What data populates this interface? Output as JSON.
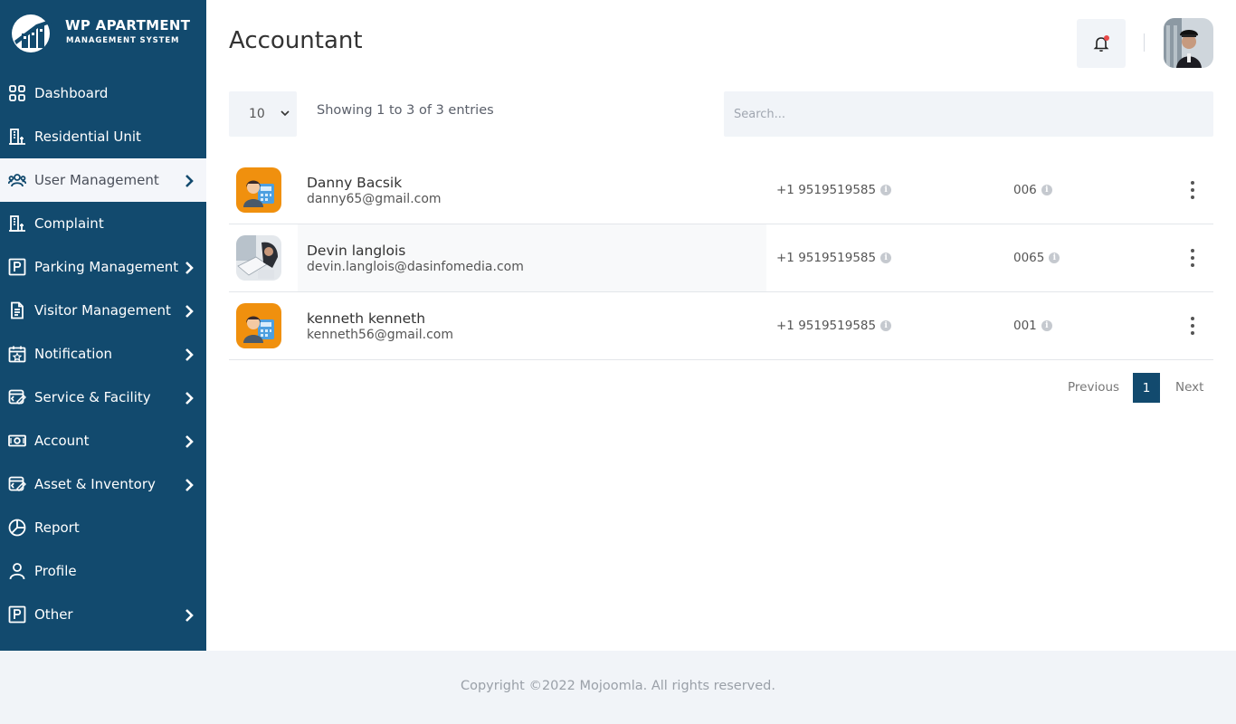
{
  "brand": {
    "title": "WP APARTMENT",
    "subtitle": "MANAGEMENT SYSTEM"
  },
  "sidebar": {
    "items": [
      {
        "label": "Dashboard",
        "icon": "dashboard-grid-icon"
      },
      {
        "label": "Residential Unit",
        "icon": "building-icon"
      },
      {
        "label": "User Management",
        "icon": "users-icon",
        "active": true
      },
      {
        "label": "Complaint",
        "icon": "building-icon"
      },
      {
        "label": "Parking Management",
        "icon": "parking-icon"
      },
      {
        "label": "Visitor Management",
        "icon": "document-icon"
      },
      {
        "label": "Notification",
        "icon": "calendar-star-icon"
      },
      {
        "label": "Service & Facility",
        "icon": "service-icon"
      },
      {
        "label": "Account",
        "icon": "money-icon"
      },
      {
        "label": "Asset & Inventory",
        "icon": "service-icon"
      },
      {
        "label": "Report",
        "icon": "pie-chart-icon"
      },
      {
        "label": "Profile",
        "icon": "user-icon"
      },
      {
        "label": "Other",
        "icon": "parking-icon"
      }
    ]
  },
  "header": {
    "title": "Accountant"
  },
  "controls": {
    "page_size": "10",
    "entries_info": "Showing 1 to 3 of 3 entries",
    "search_placeholder": "Search..."
  },
  "table": {
    "rows": [
      {
        "name": "Danny Bacsik",
        "email": "danny65@gmail.com",
        "phone": "+1 9519519585",
        "code": "006",
        "thumb": "accountant-avatar"
      },
      {
        "name": "Devin langlois",
        "email": "devin.langlois@dasinfomedia.com",
        "phone": "+1 9519519585",
        "code": "0065",
        "thumb": "photo-avatar"
      },
      {
        "name": "kenneth kenneth",
        "email": "kenneth56@gmail.com",
        "phone": "+1 9519519585",
        "code": "001",
        "thumb": "accountant-avatar"
      }
    ]
  },
  "pagination": {
    "previous": "Previous",
    "current": "1",
    "next": "Next"
  },
  "footer": {
    "text": "Copyright ©2022 Mojoomla. All rights reserved."
  },
  "colors": {
    "sidebar_bg": "#124a6e",
    "page_bg": "#ffffff",
    "panel_bg": "#f1f4f8",
    "accent_orange": "#f0900e",
    "notification_dot": "#e84a4a"
  }
}
